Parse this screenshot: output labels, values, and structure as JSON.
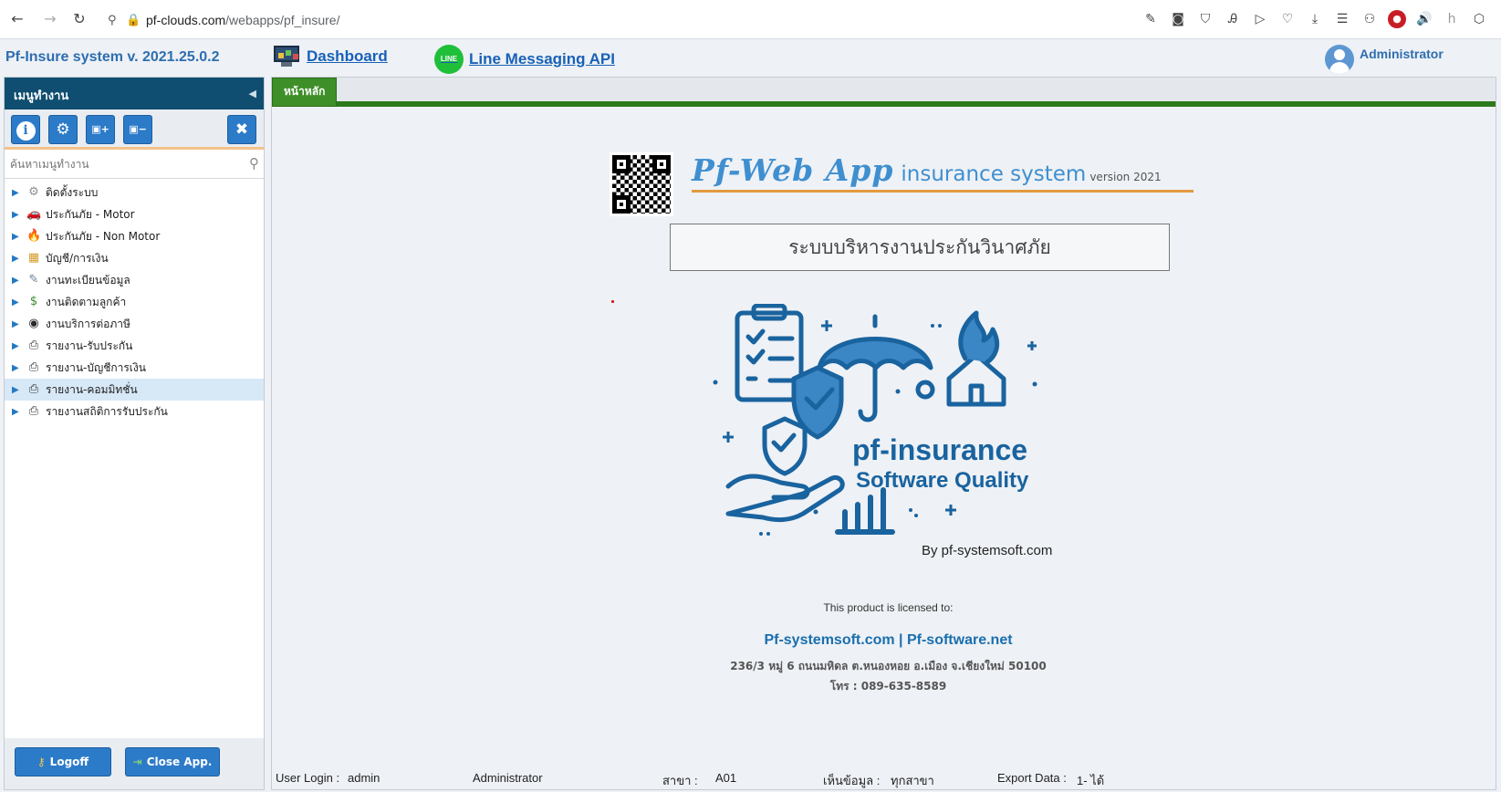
{
  "browser": {
    "url_host": "pf-clouds.com",
    "url_path": "/webapps/pf_insure/"
  },
  "header": {
    "app_title": "Pf-Insure system v. 2021.25.0.2",
    "dashboard_label": "Dashboard",
    "line_label": "Line Messaging API",
    "line_icon_text": "LINE",
    "user_name": "Administrator"
  },
  "sidebar": {
    "title": "เมนูทำงาน",
    "search_placeholder": "ค้นหาเมนูทำงาน",
    "items": [
      {
        "label": "ติดตั้งระบบ",
        "icon": "gear-icon",
        "glyph": "⚙",
        "color": "#8a8f96"
      },
      {
        "label": "ประกันภัย - Motor",
        "icon": "car-icon",
        "glyph": "🚗",
        "color": "#c73a3a"
      },
      {
        "label": "ประกันภัย - Non Motor",
        "icon": "fire-icon",
        "glyph": "🔥",
        "color": "#ef7d12"
      },
      {
        "label": "บัญชี/การเงิน",
        "icon": "calendar-icon",
        "glyph": "▦",
        "color": "#d59b2a"
      },
      {
        "label": "งานทะเบียนข้อมูล",
        "icon": "notepad-icon",
        "glyph": "✎",
        "color": "#6b7d90"
      },
      {
        "label": "งานติดตามลูกค้า",
        "icon": "money-bag-icon",
        "glyph": "$",
        "color": "#3b8b2e"
      },
      {
        "label": "งานบริการต่อภาษี",
        "icon": "tax-badge-icon",
        "glyph": "◉",
        "color": "#2b2b2b"
      },
      {
        "label": "รายงาน-รับประกัน",
        "icon": "printer-icon",
        "glyph": "⎙",
        "color": "#333333"
      },
      {
        "label": "รายงาน-บัญชีการเงิน",
        "icon": "printer-icon",
        "glyph": "⎙",
        "color": "#333333"
      },
      {
        "label": "รายงาน-คอมมิทชั่น",
        "icon": "printer-icon",
        "glyph": "⎙",
        "color": "#333333"
      },
      {
        "label": "รายงานสถิติการรับประกัน",
        "icon": "printer-icon",
        "glyph": "⎙",
        "color": "#333333"
      }
    ],
    "selected_index": 9,
    "logoff_label": "Logoff",
    "close_label": "Close App."
  },
  "main": {
    "tab_label": "หน้าหลัก",
    "brand_big": "Pf-Web App",
    "brand_mid": "insurance system",
    "brand_small": "version 2021",
    "subtitle": "ระบบบริหารงานประกันวินาศภัย",
    "logo_name": "pf-insurance",
    "logo_tagline": "Software Quality",
    "logo_by": "By pf-systemsoft.com",
    "license_label": "This product is licensed to:",
    "company": "Pf-systemsoft.com | Pf-software.net",
    "address": "236/3 หมู่ 6 ถนนมหิดล ต.หนองหอย อ.เมือง จ.เชียงใหม่ 50100",
    "phone": "โทร : 089-635-8589"
  },
  "status": {
    "user_login_label": "User Login :",
    "user_login_value": "admin",
    "role": "Administrator",
    "branch_label": "สาขา :",
    "branch_value": "A01",
    "view_label": "เห็นข้อมูล :",
    "view_value": "ทุกสาขา",
    "export_label": "Export Data :",
    "export_value": "1- ได้"
  },
  "colors": {
    "sidebar_header": "#0f4e70",
    "accent_blue": "#2c7bc9",
    "tab_green": "#3e8f28",
    "brand_blue": "#19639f"
  }
}
